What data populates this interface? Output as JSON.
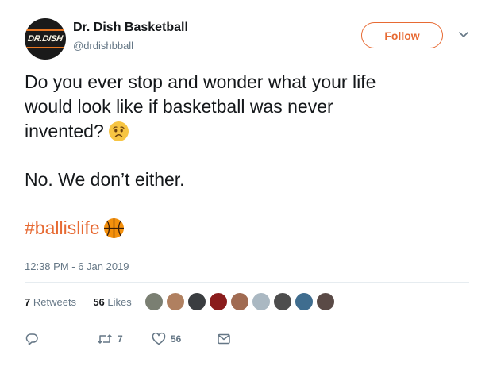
{
  "author": {
    "name": "Dr. Dish Basketball",
    "handle": "@drdishbball",
    "avatar_text": "DR.DISH"
  },
  "follow_label": "Follow",
  "tweet": {
    "lines": [
      "Do you ever stop and wonder what your life",
      "would look like if basketball was never",
      "invented?"
    ],
    "second_paragraph": "No. We don’t either.",
    "hashtag": "#ballislife",
    "emojis": [
      "worried-face-emoji",
      "basketball-emoji"
    ]
  },
  "timestamp": "12:38 PM - 6 Jan 2019",
  "stats": {
    "retweets_count": "7",
    "retweets_label": "Retweets",
    "likes_count": "56",
    "likes_label": "Likes",
    "liker_avatar_colors": [
      "#7a7f72",
      "#b08060",
      "#3a3d40",
      "#8a1c1c",
      "#a06b52",
      "#aab8c2",
      "#4d4d4d",
      "#3f6d8f",
      "#5a4a46"
    ]
  },
  "actions": {
    "reply_count": "",
    "retweet_count": "7",
    "like_count": "56"
  },
  "colors": {
    "accent": "#e76a33",
    "text": "#14171a",
    "secondary": "#657786",
    "divider": "#e6ecf0"
  }
}
